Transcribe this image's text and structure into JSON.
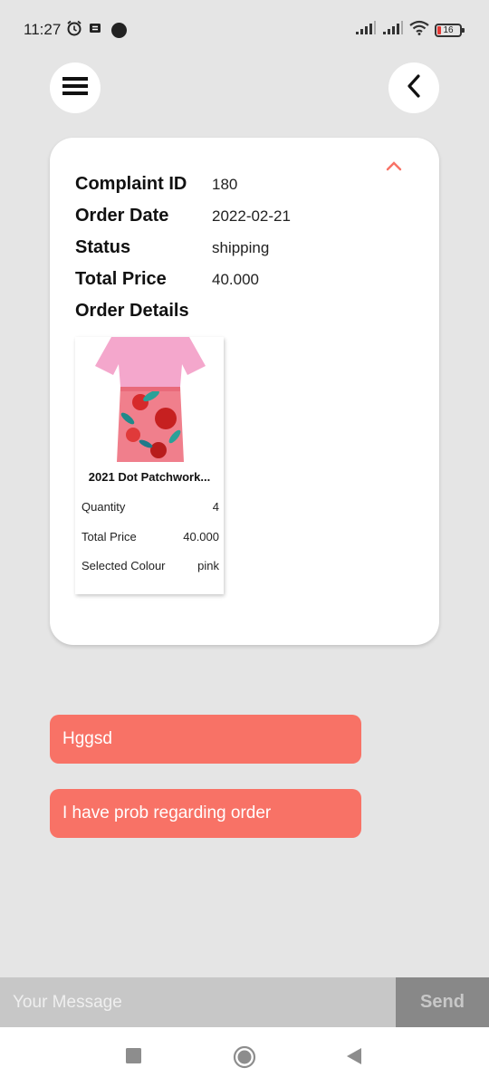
{
  "status_bar": {
    "time": "11:27",
    "battery": "16"
  },
  "header": {
    "menu_icon": "hamburger-menu-icon",
    "back_icon": "chevron-left-icon"
  },
  "complaint": {
    "fields": [
      {
        "label": "Complaint ID",
        "value": "180"
      },
      {
        "label": "Order Date",
        "value": "2022-02-21"
      },
      {
        "label": "Status",
        "value": "shipping"
      },
      {
        "label": "Total Price",
        "value": "40.000"
      }
    ],
    "details_label": "Order Details",
    "product": {
      "name": "2021 Dot Patchwork...",
      "rows": [
        {
          "label": "Quantity",
          "value": "4"
        },
        {
          "label": "Total Price",
          "value": "40.000"
        },
        {
          "label": "Selected Colour",
          "value": "pink"
        }
      ]
    }
  },
  "messages": [
    {
      "text": "Hggsd"
    },
    {
      "text": "I have prob regarding order"
    }
  ],
  "composer": {
    "placeholder": "Your Message",
    "send_label": "Send"
  },
  "colors": {
    "accent": "#f87266",
    "background": "#e5e5e5",
    "card": "#ffffff"
  }
}
